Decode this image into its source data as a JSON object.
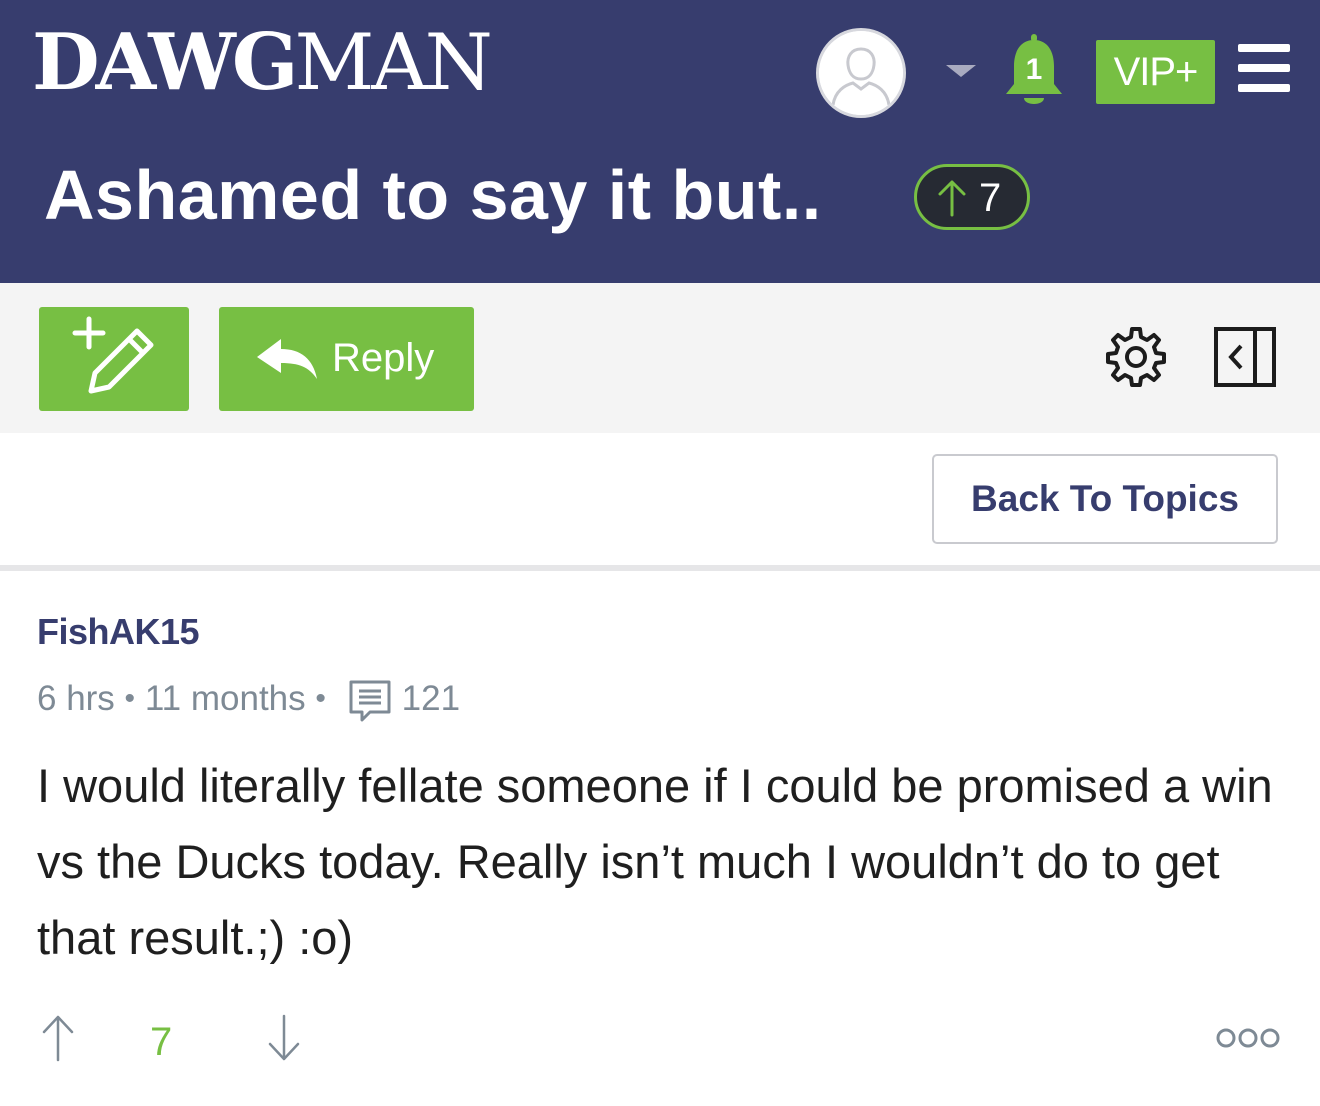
{
  "header": {
    "logo_bold": "DAWG",
    "logo_thin": "MAN",
    "avatar_icon": "user-avatar-icon",
    "dropdown_icon": "caret-down-icon",
    "notification_count": "1",
    "vip_label": "VIP+",
    "menu_icon": "hamburger-menu-icon",
    "brand_color": "#373d6e",
    "accent_color": "#77bf43"
  },
  "thread": {
    "title": "Ashamed to say it but..",
    "votes": "7"
  },
  "toolbar": {
    "new_post_icon": "new-post-pencil-icon",
    "reply_label": "Reply",
    "settings_icon": "gear-icon",
    "panel_icon": "collapse-panel-icon"
  },
  "nav": {
    "back_label": "Back To Topics"
  },
  "post": {
    "username": "FishAK15",
    "posted_ago": "6 hrs",
    "member_for": "11 months",
    "dot": "•",
    "post_count": "121",
    "body": "I would literally fellate someone if I could be promised a win vs the Ducks today. Really isn’t much I wouldn’t do to get that result.;) :o)",
    "score": "7",
    "more_icon": "more-options-icon"
  }
}
